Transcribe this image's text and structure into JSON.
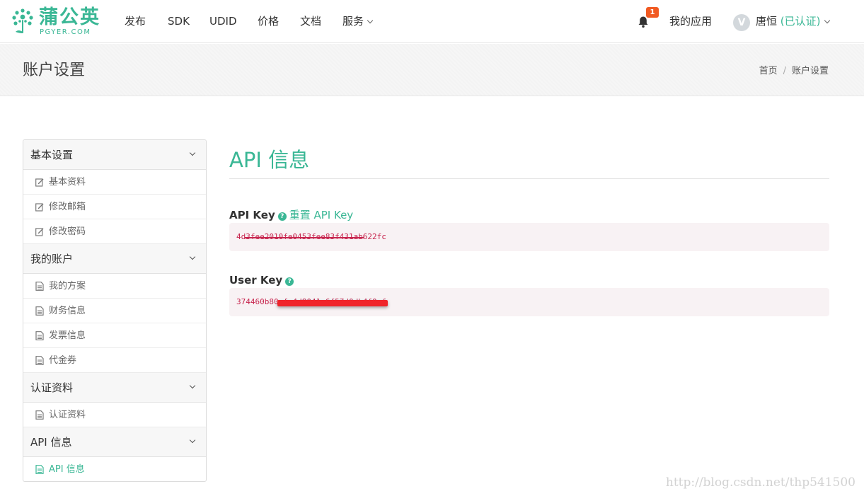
{
  "brand": {
    "name": "蒲公英",
    "sub": "PGYER.COM",
    "color": "#3ab795"
  },
  "nav": {
    "items": [
      "发布",
      "SDK",
      "UDID",
      "价格",
      "文档"
    ],
    "services_label": "服务",
    "notification_count": "1",
    "my_apps": "我的应用",
    "avatar_letter": "V",
    "user_name": "唐恒",
    "verified_label": "(已认证)"
  },
  "page": {
    "title": "账户设置",
    "breadcrumb": [
      "首页",
      "账户设置"
    ]
  },
  "sidebar": {
    "groups": [
      {
        "title": "基本设置",
        "items": [
          {
            "icon": "edit-icon",
            "label": "基本资料"
          },
          {
            "icon": "edit-icon",
            "label": "修改邮箱"
          },
          {
            "icon": "edit-icon",
            "label": "修改密码"
          }
        ]
      },
      {
        "title": "我的账户",
        "items": [
          {
            "icon": "file-icon",
            "label": "我的方案"
          },
          {
            "icon": "file-icon",
            "label": "财务信息"
          },
          {
            "icon": "file-icon",
            "label": "发票信息"
          },
          {
            "icon": "file-icon",
            "label": "代金券"
          }
        ]
      },
      {
        "title": "认证资料",
        "items": [
          {
            "icon": "file-icon",
            "label": "认证资料"
          }
        ]
      },
      {
        "title": "API 信息",
        "items": [
          {
            "icon": "file-icon",
            "label": "API 信息",
            "active": true
          }
        ]
      }
    ]
  },
  "main": {
    "title": "API 信息",
    "api_key_label": "API Key",
    "reset_label": "重置 API Key",
    "api_key_value": "4d3fee2010fe0453fee83f431ab622fc",
    "user_key_label": "User Key",
    "user_key_value": "374460b80cfe4d8041e6f57d0db4f0ef"
  },
  "watermark": "http://blog.csdn.net/thp541500"
}
